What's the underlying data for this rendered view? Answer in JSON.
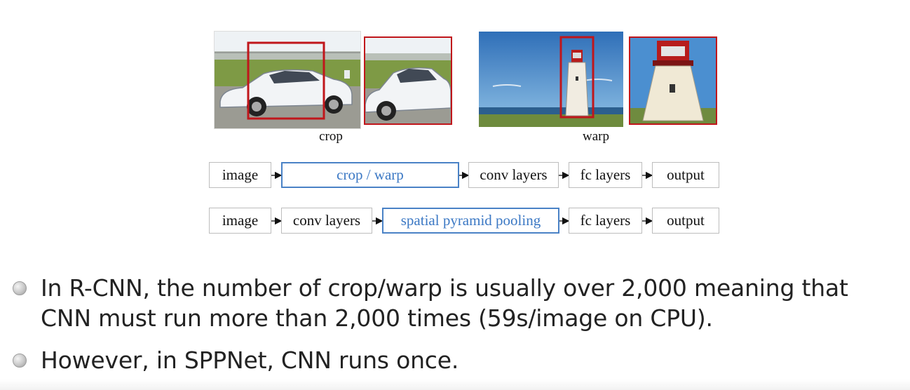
{
  "figure": {
    "captions": {
      "crop": "crop",
      "warp": "warp"
    },
    "pipeline_rcnn": [
      "image",
      "crop / warp",
      "conv layers",
      "fc layers",
      "output"
    ],
    "pipeline_sppnet": [
      "image",
      "conv layers",
      "spatial pyramid pooling",
      "fc layers",
      "output"
    ],
    "highlight_color": "#3b78c4",
    "crop_box_color": "#c0161b"
  },
  "bullets": [
    {
      "line1": "In R-CNN, the number of crop/warp is usually over 2,000 meaning that",
      "line2": "CNN must run more than 2,000 times (59s/image on CPU)."
    },
    {
      "line1": "However, in SPPNet, CNN runs once."
    }
  ]
}
